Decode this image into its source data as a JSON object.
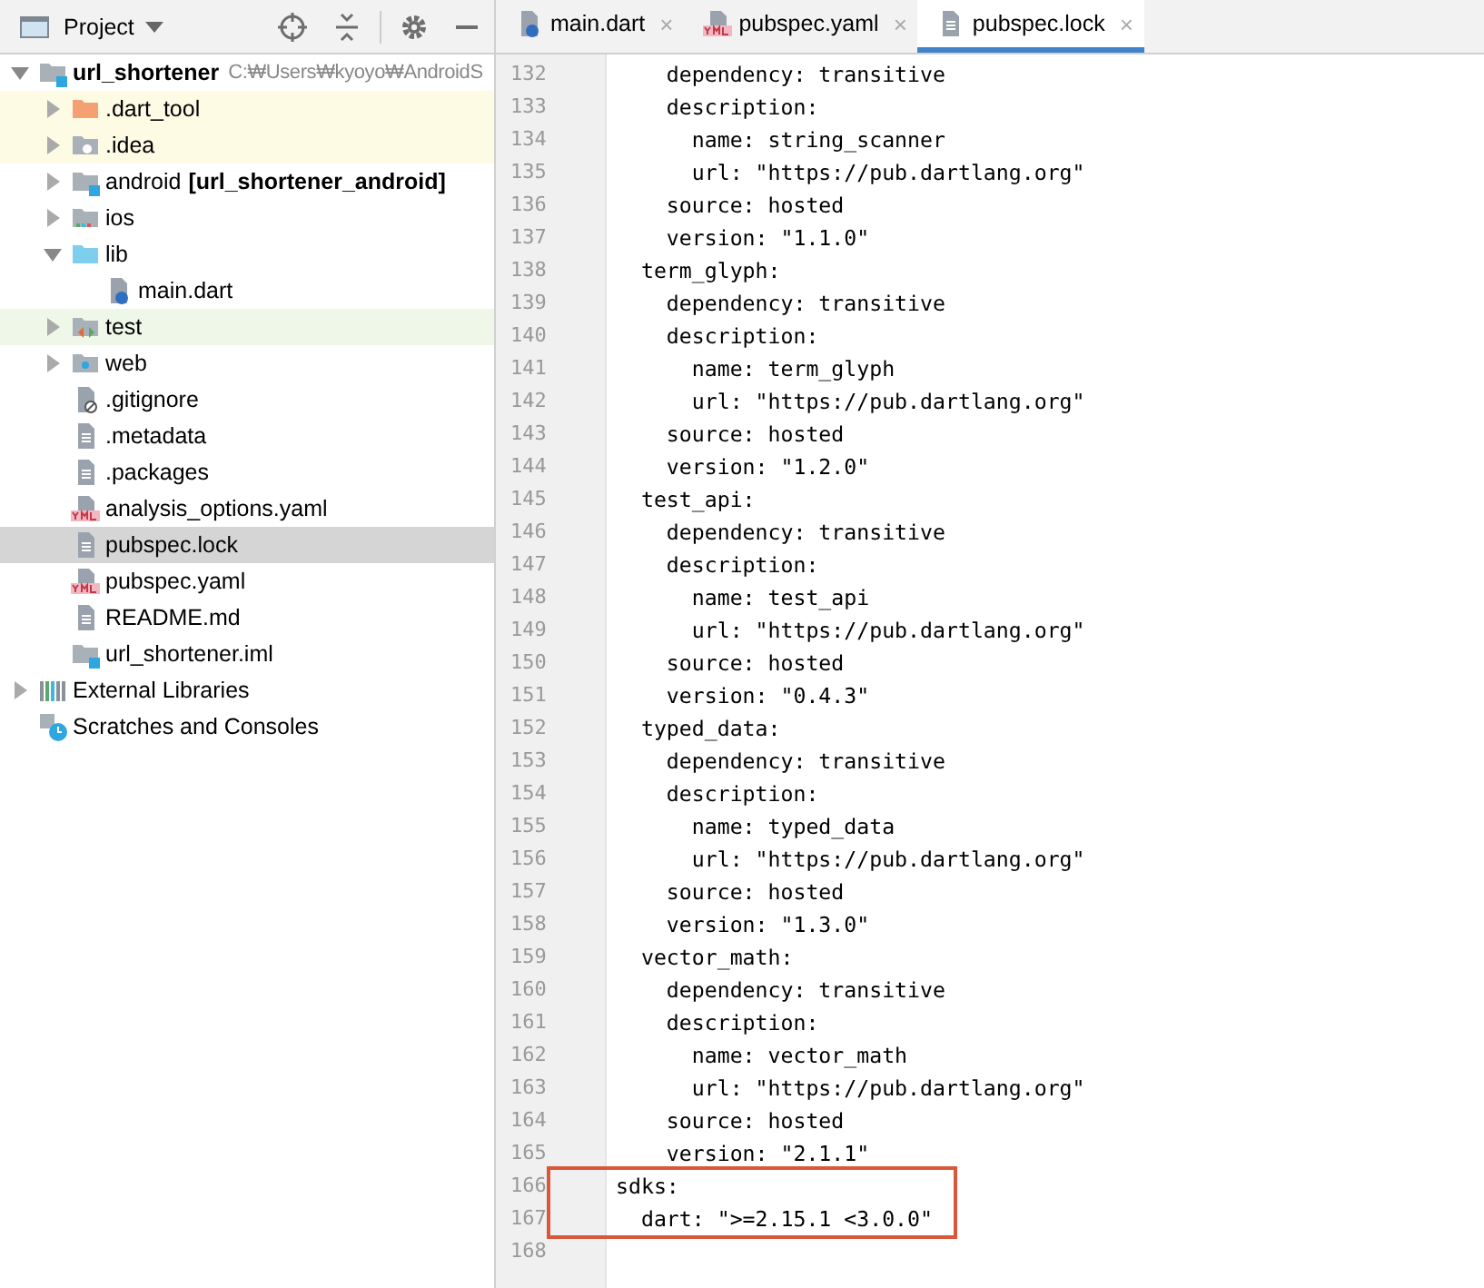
{
  "project_panel": {
    "title": "Project",
    "tree": [
      {
        "label": "url_shortener",
        "bold": true,
        "path": "C:₩Users₩kyoyo₩AndroidS",
        "kind": "module",
        "expanded": true,
        "selected": false,
        "children": [
          {
            "label": ".dart_tool",
            "kind": "excluded-folder",
            "expanded": false,
            "selected": false,
            "color": "#fdfbe4"
          },
          {
            "label": ".idea",
            "kind": "idea-folder",
            "expanded": false,
            "selected": false,
            "color": "#fdfbe4"
          },
          {
            "label": "android",
            "module": "[url_shortener_android]",
            "kind": "module",
            "expanded": false,
            "selected": false
          },
          {
            "label": "ios",
            "kind": "ios-folder",
            "expanded": false,
            "selected": false
          },
          {
            "label": "lib",
            "kind": "source-folder",
            "expanded": true,
            "selected": false,
            "children": [
              {
                "label": "main.dart",
                "kind": "dart",
                "selected": false
              }
            ]
          },
          {
            "label": "test",
            "kind": "test-folder",
            "expanded": false,
            "selected": false,
            "color": "#eff7e9"
          },
          {
            "label": "web",
            "kind": "web-folder",
            "expanded": false,
            "selected": false
          },
          {
            "label": ".gitignore",
            "kind": "ignore",
            "selected": false
          },
          {
            "label": ".metadata",
            "kind": "text",
            "selected": false
          },
          {
            "label": ".packages",
            "kind": "text",
            "selected": false
          },
          {
            "label": "analysis_options.yaml",
            "kind": "yaml",
            "selected": false
          },
          {
            "label": "pubspec.lock",
            "kind": "text",
            "selected": true
          },
          {
            "label": "pubspec.yaml",
            "kind": "yaml",
            "selected": false
          },
          {
            "label": "README.md",
            "kind": "text",
            "selected": false
          },
          {
            "label": "url_shortener.iml",
            "kind": "module",
            "selected": false
          }
        ]
      },
      {
        "label": "External Libraries",
        "kind": "libraries",
        "expanded": false,
        "selected": false
      },
      {
        "label": "Scratches and Consoles",
        "kind": "scratches",
        "selected": false
      }
    ]
  },
  "tabs": [
    {
      "label": "main.dart",
      "kind": "dart",
      "close": "×",
      "selected": false
    },
    {
      "label": "pubspec.yaml",
      "kind": "yaml",
      "close": "×",
      "selected": false
    },
    {
      "label": "pubspec.lock",
      "kind": "text",
      "close": "×",
      "selected": true
    }
  ],
  "editor": {
    "sections": [
      {
        "boxed": false,
        "lines": [
          {
            "number": "132",
            "text": "    dependency: transitive"
          },
          {
            "number": "133",
            "text": "    description:"
          },
          {
            "number": "134",
            "text": "      name: string_scanner"
          },
          {
            "number": "135",
            "text": "      url: \"https://pub.dartlang.org\""
          },
          {
            "number": "136",
            "text": "    source: hosted"
          },
          {
            "number": "137",
            "text": "    version: \"1.1.0\""
          },
          {
            "number": "138",
            "text": "  term_glyph:"
          },
          {
            "number": "139",
            "text": "    dependency: transitive"
          },
          {
            "number": "140",
            "text": "    description:"
          },
          {
            "number": "141",
            "text": "      name: term_glyph"
          },
          {
            "number": "142",
            "text": "      url: \"https://pub.dartlang.org\""
          },
          {
            "number": "143",
            "text": "    source: hosted"
          },
          {
            "number": "144",
            "text": "    version: \"1.2.0\""
          },
          {
            "number": "145",
            "text": "  test_api:"
          },
          {
            "number": "146",
            "text": "    dependency: transitive"
          },
          {
            "number": "147",
            "text": "    description:"
          },
          {
            "number": "148",
            "text": "      name: test_api"
          },
          {
            "number": "149",
            "text": "      url: \"https://pub.dartlang.org\""
          },
          {
            "number": "150",
            "text": "    source: hosted"
          },
          {
            "number": "151",
            "text": "    version: \"0.4.3\""
          },
          {
            "number": "152",
            "text": "  typed_data:"
          },
          {
            "number": "153",
            "text": "    dependency: transitive"
          },
          {
            "number": "154",
            "text": "    description:"
          },
          {
            "number": "155",
            "text": "      name: typed_data"
          },
          {
            "number": "156",
            "text": "      url: \"https://pub.dartlang.org\""
          },
          {
            "number": "157",
            "text": "    source: hosted"
          },
          {
            "number": "158",
            "text": "    version: \"1.3.0\""
          },
          {
            "number": "159",
            "text": "  vector_math:"
          },
          {
            "number": "160",
            "text": "    dependency: transitive"
          },
          {
            "number": "161",
            "text": "    description:"
          },
          {
            "number": "162",
            "text": "      name: vector_math"
          },
          {
            "number": "163",
            "text": "      url: \"https://pub.dartlang.org\""
          },
          {
            "number": "164",
            "text": "    source: hosted"
          },
          {
            "number": "165",
            "text": "    version: \"2.1.1\""
          }
        ]
      },
      {
        "boxed": true,
        "lines": [
          {
            "number": "166",
            "text": "sdks:"
          },
          {
            "number": "167",
            "text": "  dart: \">=2.15.1 <3.0.0\""
          }
        ]
      },
      {
        "boxed": false,
        "lines": [
          {
            "number": "168"
          }
        ]
      }
    ]
  }
}
